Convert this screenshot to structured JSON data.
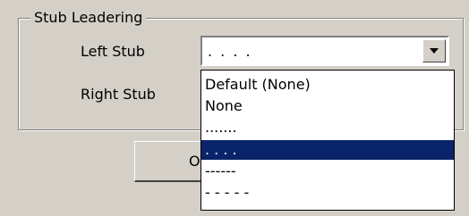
{
  "group": {
    "title": "Stub Leadering"
  },
  "left_stub": {
    "label": "Left Stub",
    "value": ". . . ."
  },
  "right_stub": {
    "label": "Right Stub"
  },
  "dropdown": {
    "options": [
      "Default (None)",
      "None",
      ".......",
      ". . . .",
      "------",
      "- - - - -"
    ],
    "selected_index": 3
  },
  "buttons": {
    "ok_partial_label": "O"
  },
  "colors": {
    "dialog_bg": "#d4d0c8",
    "selection": "#0a246a"
  }
}
